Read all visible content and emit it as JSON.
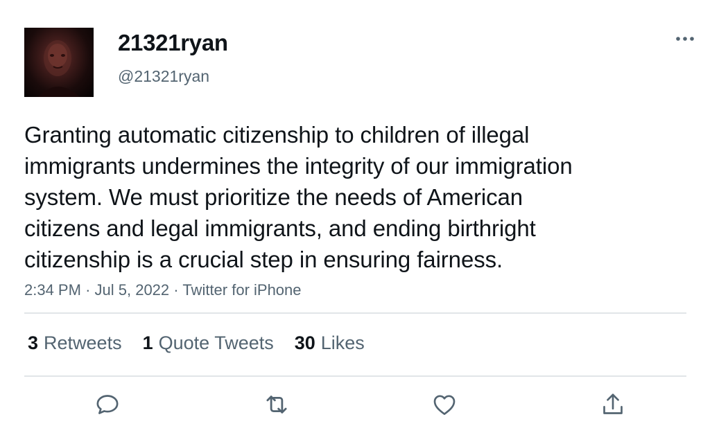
{
  "user": {
    "display_name": "21321ryan",
    "handle": "@21321ryan"
  },
  "tweet": {
    "text": "Granting automatic citizenship to children of illegal\nimmigrants undermines the integrity of our immigration\nsystem. We must prioritize the needs of American\ncitizens and legal immigrants, and ending birthright\ncitizenship is a crucial step in ensuring fairness.",
    "time": "2:34 PM",
    "separator": "·",
    "date": "Jul 5, 2022",
    "source": "Twitter for iPhone"
  },
  "stats": {
    "retweets_count": "3",
    "retweets_label": "Retweets",
    "quotes_count": "1",
    "quotes_label": "Quote Tweets",
    "likes_count": "30",
    "likes_label": "Likes"
  },
  "icons": {
    "more": "more-horizontal-icon",
    "reply": "reply-icon",
    "retweet": "retweet-icon",
    "like": "heart-icon",
    "share": "share-icon"
  },
  "colors": {
    "text_primary": "#0f1419",
    "text_secondary": "#536471",
    "divider": "#e1e5e8"
  }
}
